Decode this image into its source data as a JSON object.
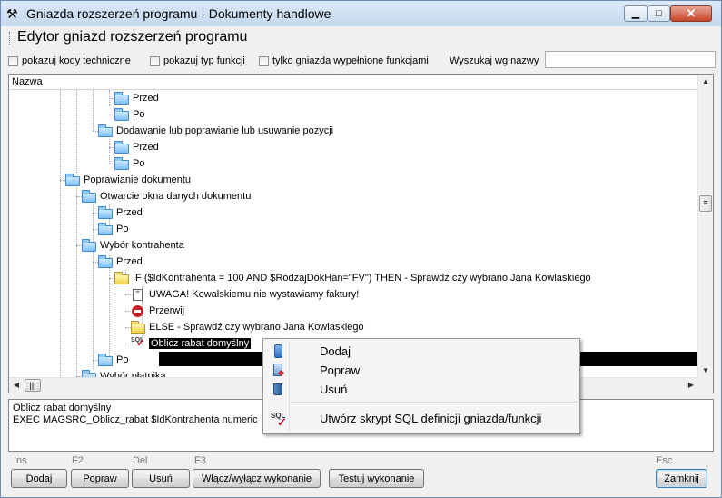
{
  "window": {
    "title": "Gniazda rozszerzeń programu - Dokumenty handlowe",
    "controls": {
      "minimize": "▁",
      "maximize": "□",
      "close": "✕"
    }
  },
  "header": {
    "title": "Edytor gniazd rozszerzeń programu"
  },
  "options": {
    "show_tech_codes": "pokazuj kody techniczne",
    "show_func_type": "pokazuj typ funkcji",
    "only_filled": "tylko gniazda wypełnione funkcjami",
    "search_label": "Wyszukaj wg nazwy",
    "search_value": ""
  },
  "tree": {
    "column_header": "Nazwa",
    "nodes": [
      {
        "label": "Przed"
      },
      {
        "label": "Po"
      },
      {
        "label": "Dodawanie lub poprawianie lub usuwanie pozycji"
      },
      {
        "label": "Przed"
      },
      {
        "label": "Po"
      },
      {
        "label": "Poprawianie dokumentu"
      },
      {
        "label": "Otwarcie okna danych dokumentu"
      },
      {
        "label": "Przed"
      },
      {
        "label": "Po"
      },
      {
        "label": "Wybór kontrahenta"
      },
      {
        "label": "Przed"
      },
      {
        "label": "IF ($IdKontrahenta = 100 AND $RodzajDokHan=\"FV\") THEN - Sprawdź czy wybrano Jana Kowlaskiego"
      },
      {
        "label": "UWAGA! Kowalskiemu nie wystawiamy faktury!"
      },
      {
        "label": "Przerwij"
      },
      {
        "label": "ELSE - Sprawdź czy wybrano Jana Kowlaskiego"
      },
      {
        "label": "Oblicz rabat domyślny"
      },
      {
        "label": "Po"
      },
      {
        "label": "Wybór płatnika"
      }
    ]
  },
  "description": {
    "line1": "Oblicz rabat domyślny",
    "line2": "EXEC MAGSRC_Oblicz_rabat $IdKontrahenta numeric"
  },
  "buttons": [
    {
      "hotkey": "Ins",
      "label": "Dodaj"
    },
    {
      "hotkey": "F2",
      "label": "Popraw"
    },
    {
      "hotkey": "Del",
      "label": "Usuń"
    },
    {
      "hotkey": "F3",
      "label": "Włącz/wyłącz wykonanie"
    },
    {
      "hotkey": "",
      "label": "Testuj wykonanie"
    },
    {
      "hotkey": "Esc",
      "label": "Zamknij"
    }
  ],
  "context_menu": {
    "items": [
      {
        "label": "Dodaj",
        "icon": "add-icon"
      },
      {
        "label": "Popraw",
        "icon": "edit-icon"
      },
      {
        "label": "Usuń",
        "icon": "trash-icon"
      },
      {
        "label": "Utwórz skrypt SQL definicji gniazda/funkcji",
        "icon": "sql-script-icon"
      }
    ]
  },
  "colors": {
    "selection": "#000000",
    "folder_blue": "#7ec0f7",
    "folder_yellow": "#f1d24a",
    "accent_border": "#3c7fb1"
  }
}
